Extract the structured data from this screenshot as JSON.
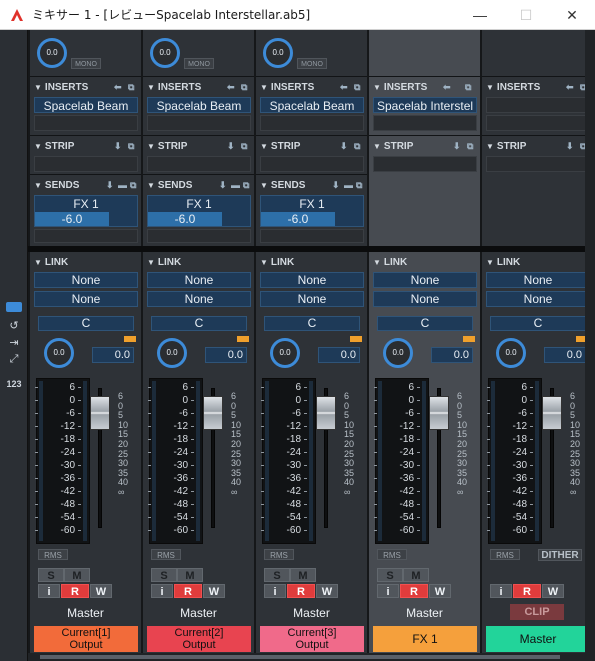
{
  "window": {
    "title": "ミキサー 1 - [レビューSpacelab Interstellar.ab5]",
    "min": "—",
    "max": "☐",
    "close": "✕"
  },
  "left_strip": {
    "num_label": "123"
  },
  "labels": {
    "inserts": "INSERTS",
    "strip": "STRIP",
    "sends": "SENDS",
    "link": "LINK",
    "mono": "MONO",
    "rms": "RMS",
    "dither": "DITHER",
    "clip": "CLIP",
    "s": "S",
    "m": "M",
    "i": "i",
    "r": "R",
    "w": "W"
  },
  "scale_left": [
    "6",
    "0",
    "-6",
    "-12",
    "-18",
    "-24",
    "-30",
    "-36",
    "-42",
    "-48",
    "-54",
    "-60"
  ],
  "scale_right": [
    "6",
    "0",
    "5",
    "10",
    "15",
    "20",
    "25",
    "30",
    "35",
    "40",
    "∞"
  ],
  "channels": [
    {
      "pan": "0.0",
      "insert": "Spacelab Beam",
      "send_name": "FX 1",
      "send_value": "-6.0",
      "link1": "None",
      "link2": "None",
      "tune": "C",
      "pan2": "0.0",
      "gain": "0.0",
      "output": "Master",
      "name_line1": "Current[1]",
      "name_line2": "Output",
      "name_color": "#f26b3a"
    },
    {
      "pan": "0.0",
      "insert": "Spacelab Beam",
      "send_name": "FX 1",
      "send_value": "-6.0",
      "link1": "None",
      "link2": "None",
      "tune": "C",
      "pan2": "0.0",
      "gain": "0.0",
      "output": "Master",
      "name_line1": "Current[2]",
      "name_line2": "Output",
      "name_color": "#e84450"
    },
    {
      "pan": "0.0",
      "insert": "Spacelab Beam",
      "send_name": "FX 1",
      "send_value": "-6.0",
      "link1": "None",
      "link2": "None",
      "tune": "C",
      "pan2": "0.0",
      "gain": "0.0",
      "output": "Master",
      "name_line1": "Current[3]",
      "name_line2": "Output",
      "name_color": "#f06a8a"
    },
    {
      "insert": "Spacelab Interstel",
      "link1": "None",
      "link2": "None",
      "tune": "C",
      "pan2": "0.0",
      "gain": "0.0",
      "output": "Master",
      "name_line1": "FX 1",
      "name_color": "#f5a03c"
    },
    {
      "link1": "None",
      "link2": "None",
      "tune": "C",
      "pan2": "0.0",
      "gain": "0.0",
      "name_line1": "Master",
      "name_color": "#22d49a"
    }
  ]
}
